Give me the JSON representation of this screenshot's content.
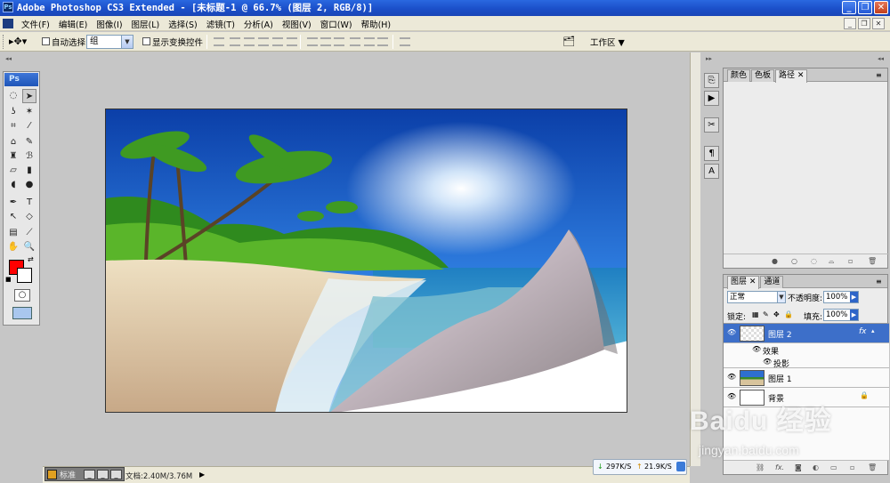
{
  "window": {
    "title": "Adobe Photoshop CS3 Extended - [未标题-1 @ 66.7% (图层 2, RGB/8)]",
    "ps_logo": "Ps"
  },
  "menubar": {
    "items": [
      "文件(F)",
      "编辑(E)",
      "图像(I)",
      "图层(L)",
      "选择(S)",
      "滤镜(T)",
      "分析(A)",
      "视图(V)",
      "窗口(W)",
      "帮助(H)"
    ]
  },
  "options_bar": {
    "auto_select_label": "自动选择:",
    "auto_select_value": "组",
    "show_transform_label": "显示变换控件",
    "workspace_label": "工作区"
  },
  "tools": {
    "header": "Ps",
    "foreground_color": "#ff0000",
    "background_color": "#ffffff"
  },
  "status": {
    "minimized_doc_label": "标准",
    "doc_size": "文档:2.40M/3.76M",
    "net_down": "297K/S",
    "net_up": "21.9K/S"
  },
  "panels": {
    "color_tabs": [
      "颜色",
      "色板",
      "路径"
    ],
    "layers_tabs": [
      "图层",
      "通道"
    ],
    "blend_mode": "正常",
    "opacity_label": "不透明度:",
    "opacity_value": "100%",
    "lock_label": "锁定:",
    "fill_label": "填充:",
    "fill_value": "100%",
    "layers": [
      {
        "name": "图层 2",
        "selected": true
      },
      {
        "name": "效果",
        "selected": false
      },
      {
        "name": "投影",
        "selected": false
      },
      {
        "name": "图层 1",
        "selected": false
      },
      {
        "name": "背景",
        "selected": false
      }
    ]
  },
  "watermark": {
    "brand": "Baidu 经验",
    "url": "jingyan.baidu.com"
  },
  "colors": {
    "titlebar": "#1f55c8",
    "selected_layer": "#3d6fc9",
    "chrome": "#ece9d8"
  }
}
